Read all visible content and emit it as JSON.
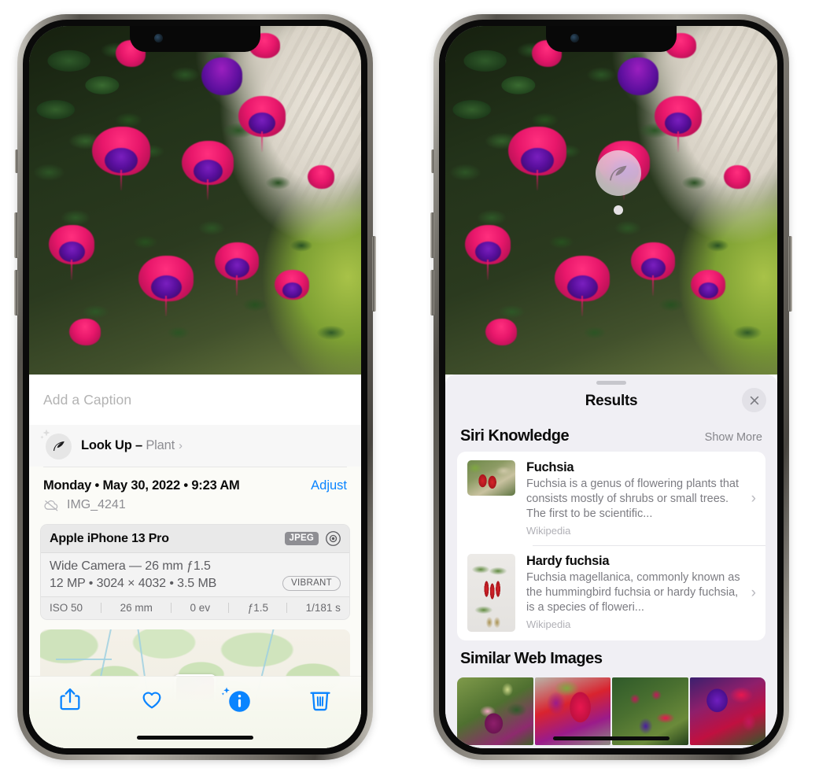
{
  "left_phone": {
    "photo": {
      "alt": "fuchsia-flowers-photo",
      "leaf_badge_icon": "leaf-icon"
    },
    "caption": {
      "placeholder": "Add a Caption",
      "value": ""
    },
    "lookup": {
      "icon": "leaf-icon",
      "sparkle_icon": "sparkles-icon",
      "label": "Look Up – ",
      "subject": "Plant",
      "chevron": "›"
    },
    "date_row": {
      "date": "Monday • May 30, 2022 • 9:23 AM",
      "adjust_label": "Adjust",
      "cloud_icon": "cloud-slash-icon",
      "filename": "IMG_4241"
    },
    "exif": {
      "device": "Apple iPhone 13 Pro",
      "format_chip": "JPEG",
      "aperture_icon": "aperture-icon",
      "lens_line": "Wide Camera — 26 mm ƒ1.5",
      "spec_line": "12 MP • 3024 × 4032 • 3.5 MB",
      "style_chip": "VIBRANT",
      "stats": [
        "ISO 50",
        "26 mm",
        "0 ev",
        "ƒ1.5",
        "1/181 s"
      ]
    },
    "map": {
      "name": "photo-location-map",
      "pin_label": "photo-pin"
    },
    "toolbar": [
      {
        "name": "share-button",
        "icon": "share-icon"
      },
      {
        "name": "favorite-button",
        "icon": "heart-icon"
      },
      {
        "name": "info-button",
        "icon": "info-sparkle-icon"
      },
      {
        "name": "delete-button",
        "icon": "trash-icon"
      }
    ],
    "accent_color": "#0a84ff"
  },
  "right_phone": {
    "photo": {
      "alt": "fuchsia-flowers-photo",
      "leaf_badge_icon": "leaf-icon"
    },
    "sheet": {
      "grabber": "sheet-grabber",
      "title": "Results",
      "close_icon": "close-icon"
    },
    "siri_knowledge": {
      "title": "Siri Knowledge",
      "show_more": "Show More",
      "items": [
        {
          "title": "Fuchsia",
          "description": "Fuchsia is a genus of flowering plants that consists mostly of shrubs or small trees. The first to be scientific...",
          "source": "Wikipedia",
          "thumb": "fuchsia-red-flowers-thumb",
          "chevron": "›"
        },
        {
          "title": "Hardy fuchsia",
          "description": "Fuchsia magellanica, commonly known as the hummingbird fuchsia or hardy fuchsia, is a species of floweri...",
          "source": "Wikipedia",
          "thumb": "hardy-fuchsia-specimen-thumb",
          "chevron": "›"
        }
      ]
    },
    "similar_web_images": {
      "title": "Similar Web Images",
      "images": [
        "web-image-1-pink-fuchsia",
        "web-image-2-red-fuchsia",
        "web-image-3-fuchsia-bush",
        "web-image-4-purple-fuchsia"
      ]
    }
  }
}
